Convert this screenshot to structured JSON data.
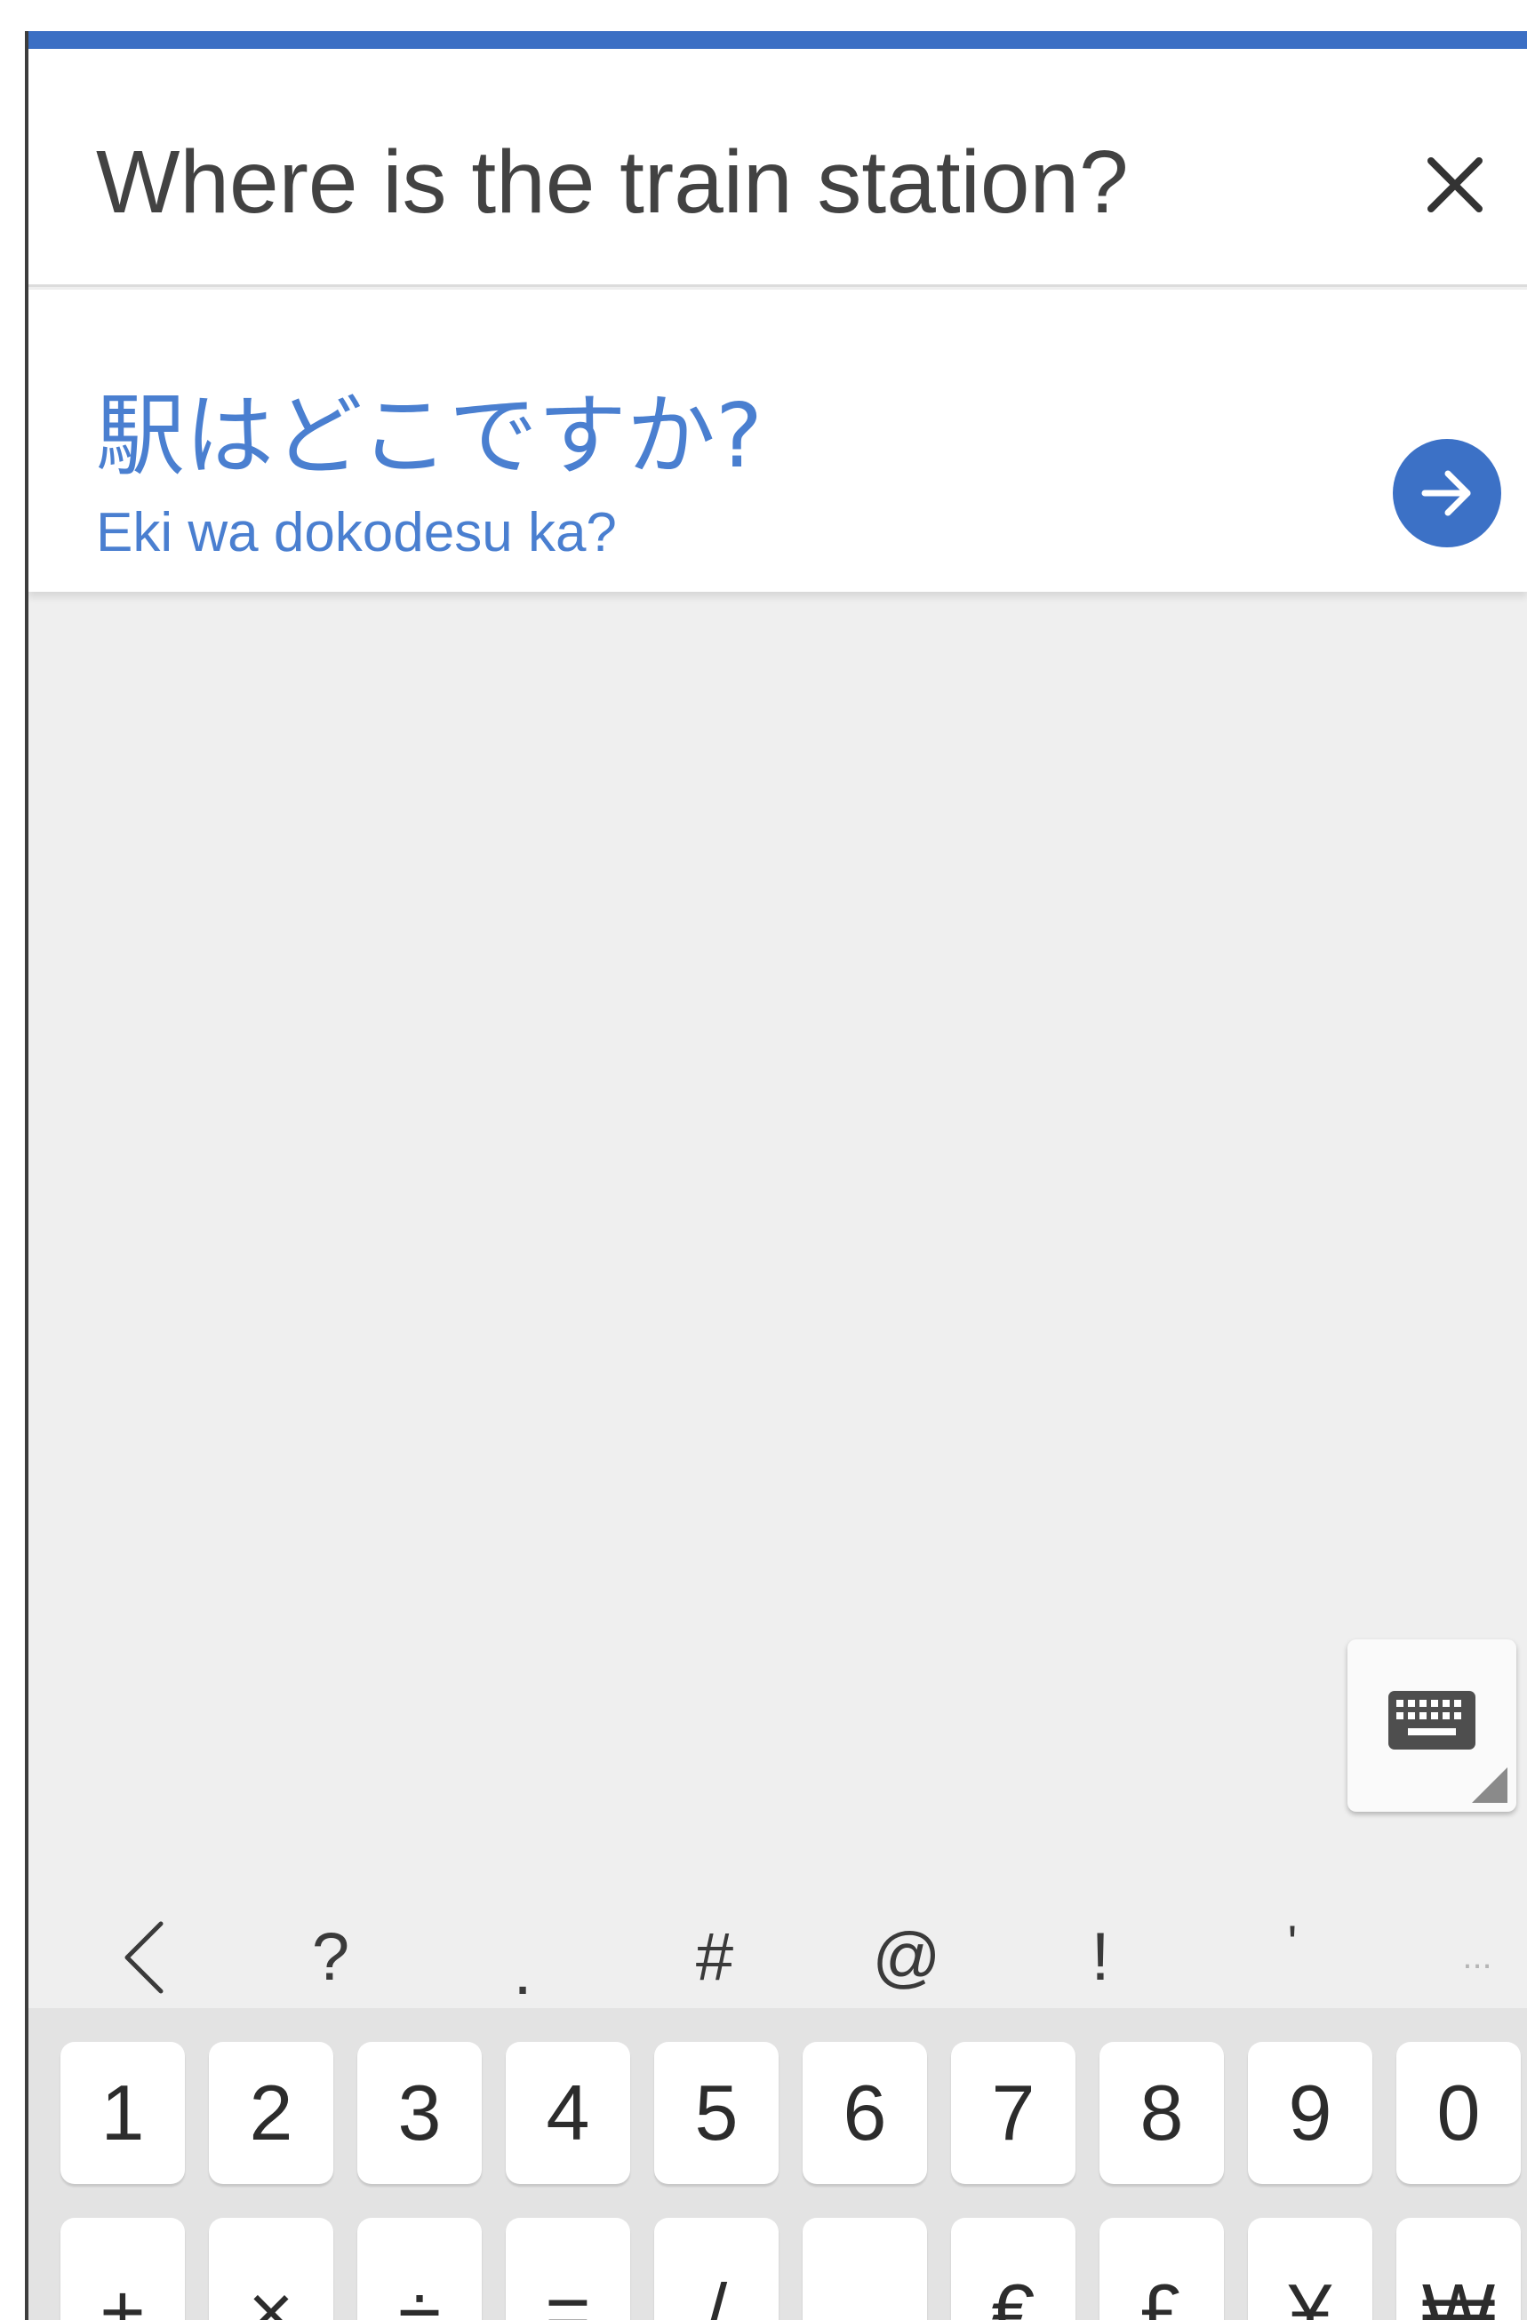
{
  "source": {
    "text": "Where is the train station?"
  },
  "result": {
    "translation": "駅はどこですか?",
    "romanization": "Eki wa dokodesu ka?"
  },
  "suggestions": [
    "<",
    "?",
    ".",
    "#",
    "@",
    "!",
    "'",
    "..."
  ],
  "keyboard": {
    "row1": [
      "1",
      "2",
      "3",
      "4",
      "5",
      "6",
      "7",
      "8",
      "9",
      "0"
    ],
    "row2": [
      "+",
      "×",
      "÷",
      "=",
      "/",
      "_",
      "€",
      "£",
      "¥",
      "₩"
    ]
  },
  "colors": {
    "accent": "#3b6fc4",
    "translation_text": "#4a7fd0",
    "background": "#efefef"
  }
}
